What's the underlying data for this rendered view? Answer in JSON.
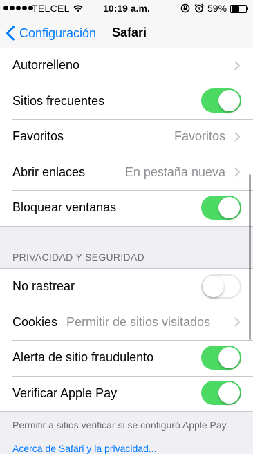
{
  "status_bar": {
    "carrier": "TELCEL",
    "time": "10:19 a.m.",
    "battery_percent_label": "59%",
    "battery_level": 0.59,
    "icons": [
      "signal-dots",
      "wifi-icon",
      "rotation-lock-icon",
      "alarm-icon",
      "battery-icon"
    ]
  },
  "nav": {
    "back_label": "Configuración",
    "title": "Safari"
  },
  "group1": {
    "rows": [
      {
        "label": "Autorrelleno",
        "type": "chevron"
      },
      {
        "label": "Sitios frecuentes",
        "type": "toggle",
        "on": true
      },
      {
        "label": "Favoritos",
        "value": "Favoritos",
        "type": "chevron"
      },
      {
        "label": "Abrir enlaces",
        "value": "En pestaña nueva",
        "type": "chevron"
      },
      {
        "label": "Bloquear ventanas",
        "type": "toggle",
        "on": true
      }
    ]
  },
  "privacy": {
    "header": "PRIVACIDAD Y SEGURIDAD",
    "rows": [
      {
        "label": "No rastrear",
        "type": "toggle",
        "on": false
      },
      {
        "label": "Cookies",
        "value": "Permitir de sitios visitados",
        "type": "chevron"
      },
      {
        "label": "Alerta de sitio fraudulento",
        "type": "toggle",
        "on": true
      },
      {
        "label": "Verificar Apple Pay",
        "type": "toggle",
        "on": true
      }
    ],
    "footer": "Permitir a sitios verificar si se configuró Apple Pay.",
    "footer_link": "Acerca de Safari y la privacidad..."
  },
  "colors": {
    "accent": "#007aff",
    "toggle_on": "#4cd964",
    "background": "#efeff4",
    "secondary_text": "#8e8e93"
  }
}
